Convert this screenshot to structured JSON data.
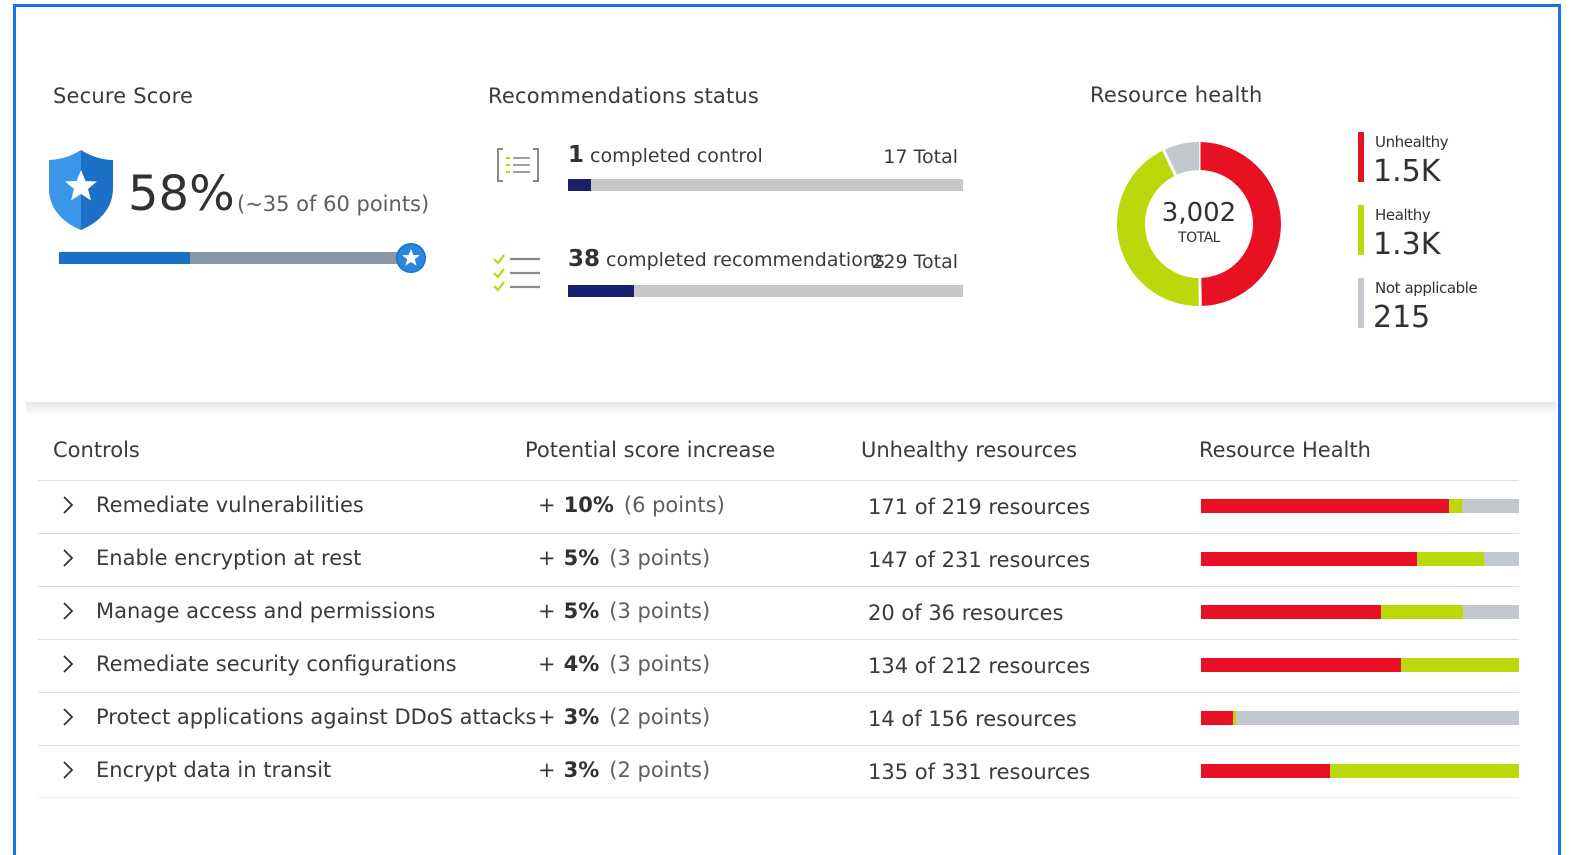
{
  "colors": {
    "frame": "#1a73e8",
    "unhealthy": "#e81123",
    "healthy": "#bad80a",
    "not_applicable": "#c3c8ce",
    "score_blue": "#1b70c8",
    "rec_navy": "#18206e"
  },
  "secure_score": {
    "title": "Secure Score",
    "percent_label": "58%",
    "points_label": "(~35 of 60 points)",
    "fraction": 0.6,
    "icon": "shield-star-icon"
  },
  "recommendations": {
    "title": "Recommendations status",
    "controls": {
      "icon": "checklist-bracket-icon",
      "count": "1",
      "label": "completed control",
      "total_label": "17 Total",
      "completed": 1,
      "total": 17
    },
    "recs": {
      "icon": "checklist-icon",
      "count": "38",
      "label": "completed recommendations",
      "total_label": "229 Total",
      "completed": 38,
      "total": 229
    }
  },
  "resource_health": {
    "title": "Resource health",
    "total_value": "3,002",
    "total_label": "TOTAL",
    "legend": [
      {
        "label": "Unhealthy",
        "value": "1.5K",
        "color": "#e81123",
        "amount": 1500
      },
      {
        "label": "Healthy",
        "value": "1.3K",
        "color": "#bad80a",
        "amount": 1300
      },
      {
        "label": "Not applicable",
        "value": "215",
        "color": "#c3c8ce",
        "amount": 215
      }
    ]
  },
  "table": {
    "headers": {
      "controls": "Controls",
      "increase": "Potential score increase",
      "unhealthy": "Unhealthy resources",
      "health": "Resource Health"
    },
    "rows": [
      {
        "control": "Remediate vulnerabilities",
        "plus": "+",
        "pct": "10%",
        "pts": "(6 points)",
        "unhealthy": "171 of 219 resources",
        "health": {
          "unhealthy": 0.78,
          "healthy": 0.04,
          "na": 0.18
        }
      },
      {
        "control": "Enable encryption at rest",
        "plus": "+",
        "pct": "5%",
        "pts": "(3 points)",
        "unhealthy": "147 of 231 resources",
        "health": {
          "unhealthy": 0.68,
          "healthy": 0.21,
          "na": 0.11
        }
      },
      {
        "control": "Manage access and permissions",
        "plus": "+",
        "pct": "5%",
        "pts": "(3 points)",
        "unhealthy": "20 of 36 resources",
        "health": {
          "unhealthy": 0.565,
          "healthy": 0.26,
          "na": 0.175
        }
      },
      {
        "control": "Remediate security configurations",
        "plus": "+",
        "pct": "4%",
        "pts": "(3 points)",
        "unhealthy": "134 of 212 resources",
        "health": {
          "unhealthy": 0.63,
          "healthy": 0.37,
          "na": 0.0
        }
      },
      {
        "control": "Protect applications against DDoS attacks",
        "plus": "+",
        "pct": "3%",
        "pts": "(2 points)",
        "unhealthy": "14 of 156 resources",
        "health": {
          "unhealthy": 0.1,
          "healthy": 0.01,
          "na": 0.89
        }
      },
      {
        "control": "Encrypt data in transit",
        "plus": "+",
        "pct": "3%",
        "pts": "(2 points)",
        "unhealthy": "135 of 331 resources",
        "health": {
          "unhealthy": 0.405,
          "healthy": 0.595,
          "na": 0.0
        }
      }
    ]
  }
}
